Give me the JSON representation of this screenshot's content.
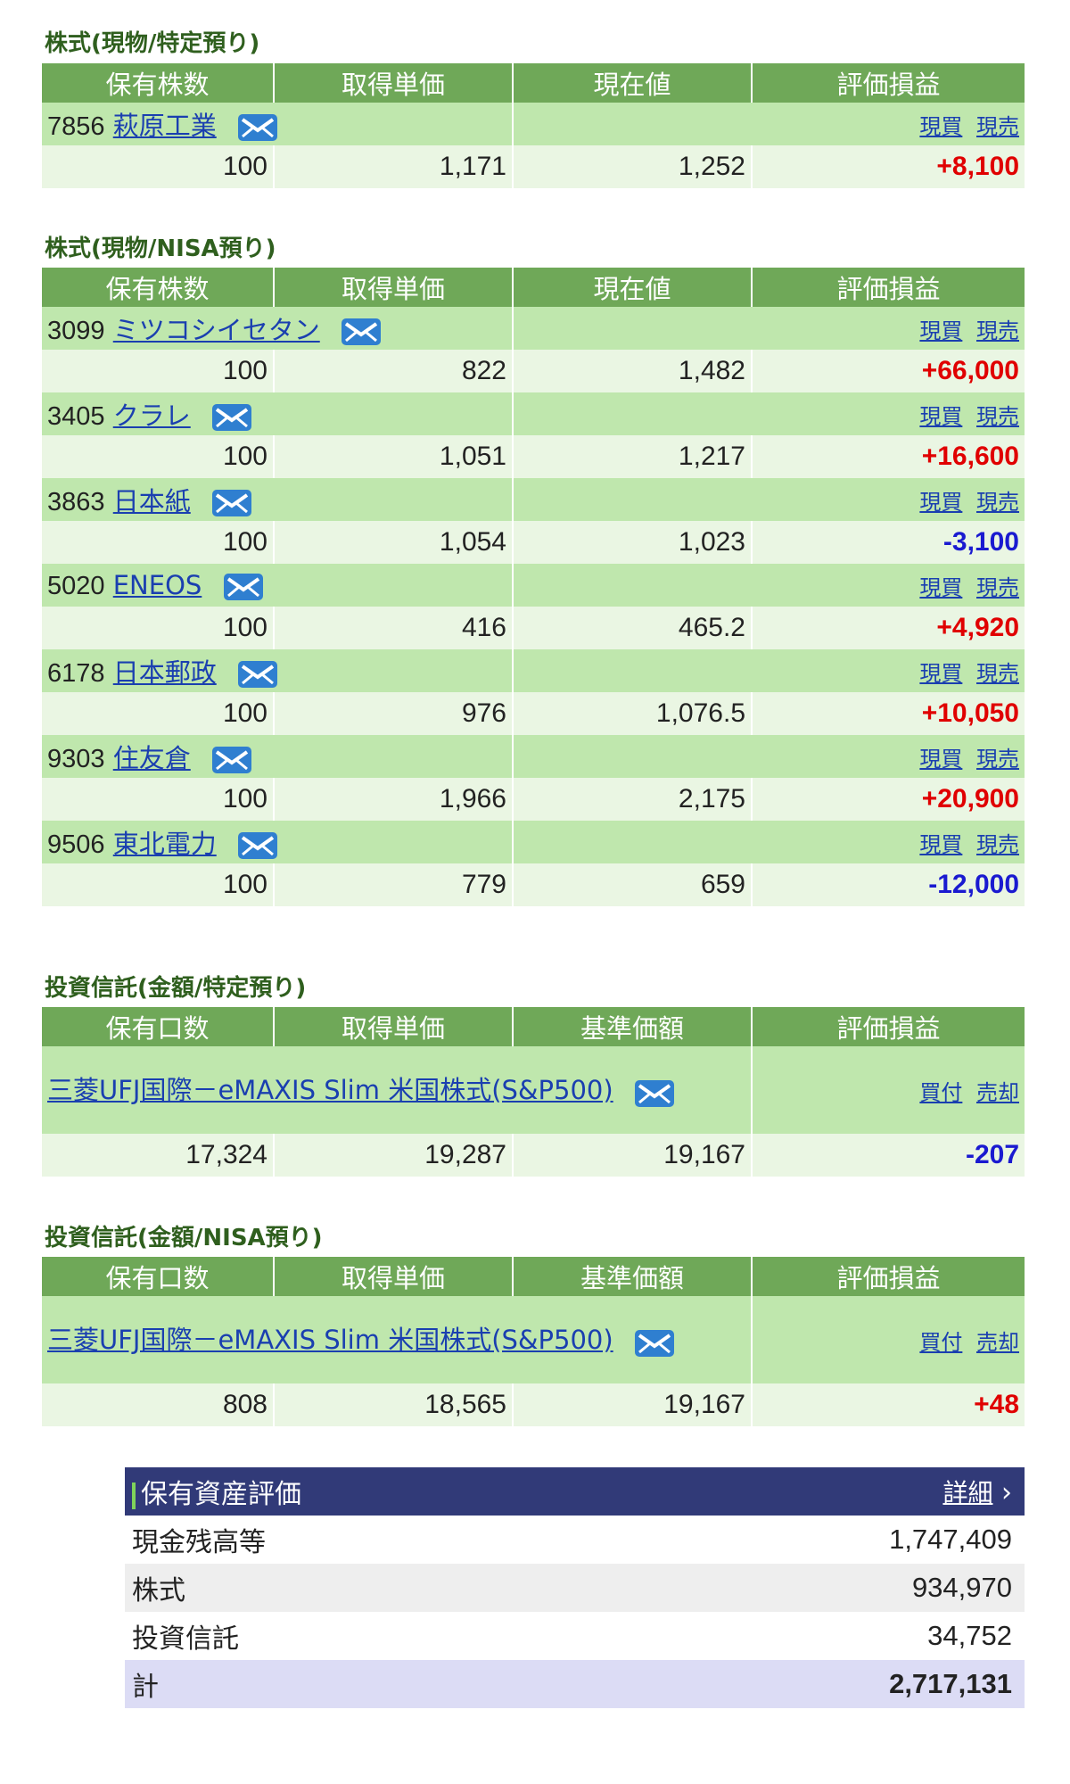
{
  "sections": [
    {
      "title": "株式(現物/特定預り)",
      "headers": [
        "保有株数",
        "取得単価",
        "現在値",
        "評価損益"
      ],
      "items": [
        {
          "code": "7856",
          "name": "萩原工業",
          "trade": [
            "現買",
            "現売"
          ],
          "qty": "100",
          "cost": "1,171",
          "price": "1,252",
          "pl": "+8,100",
          "sign": "pos"
        }
      ]
    },
    {
      "title": "株式(現物/NISA預り)",
      "headers": [
        "保有株数",
        "取得単価",
        "現在値",
        "評価損益"
      ],
      "items": [
        {
          "code": "3099",
          "name": "ミツコシイセタン",
          "trade": [
            "現買",
            "現売"
          ],
          "qty": "100",
          "cost": "822",
          "price": "1,482",
          "pl": "+66,000",
          "sign": "pos"
        },
        {
          "code": "3405",
          "name": "クラレ",
          "trade": [
            "現買",
            "現売"
          ],
          "qty": "100",
          "cost": "1,051",
          "price": "1,217",
          "pl": "+16,600",
          "sign": "pos"
        },
        {
          "code": "3863",
          "name": "日本紙",
          "trade": [
            "現買",
            "現売"
          ],
          "qty": "100",
          "cost": "1,054",
          "price": "1,023",
          "pl": "-3,100",
          "sign": "neg"
        },
        {
          "code": "5020",
          "name": "ENEOS",
          "trade": [
            "現買",
            "現売"
          ],
          "qty": "100",
          "cost": "416",
          "price": "465.2",
          "pl": "+4,920",
          "sign": "pos"
        },
        {
          "code": "6178",
          "name": "日本郵政",
          "trade": [
            "現買",
            "現売"
          ],
          "qty": "100",
          "cost": "976",
          "price": "1,076.5",
          "pl": "+10,050",
          "sign": "pos"
        },
        {
          "code": "9303",
          "name": "住友倉",
          "trade": [
            "現買",
            "現売"
          ],
          "qty": "100",
          "cost": "1,966",
          "price": "2,175",
          "pl": "+20,900",
          "sign": "pos"
        },
        {
          "code": "9506",
          "name": "東北電力",
          "trade": [
            "現買",
            "現売"
          ],
          "qty": "100",
          "cost": "779",
          "price": "659",
          "pl": "-12,000",
          "sign": "neg"
        }
      ]
    },
    {
      "title": "投資信託(金額/特定預り)",
      "headers": [
        "保有口数",
        "取得単価",
        "基準価額",
        "評価損益"
      ],
      "items": [
        {
          "fund": true,
          "name": "三菱UFJ国際－eMAXIS Slim 米国株式(S&P500)",
          "trade": [
            "買付",
            "売却"
          ],
          "qty": "17,324",
          "cost": "19,287",
          "price": "19,167",
          "pl": "-207",
          "sign": "neg"
        }
      ]
    },
    {
      "title": "投資信託(金額/NISA預り)",
      "headers": [
        "保有口数",
        "取得単価",
        "基準価額",
        "評価損益"
      ],
      "items": [
        {
          "fund": true,
          "name": "三菱UFJ国際－eMAXIS Slim 米国株式(S&P500)",
          "trade": [
            "買付",
            "売却"
          ],
          "qty": "808",
          "cost": "18,565",
          "price": "19,167",
          "pl": "+48",
          "sign": "pos"
        }
      ]
    }
  ],
  "summary": {
    "title": "保有資産評価",
    "detail_label": "詳細",
    "rows": [
      {
        "label": "現金残高等",
        "value": "1,747,409"
      },
      {
        "label": "株式",
        "value": "934,970"
      },
      {
        "label": "投資信託",
        "value": "34,752"
      }
    ],
    "total_label": "計",
    "total_value": "2,717,131"
  },
  "colors": {
    "header_green": "#6fa858",
    "name_row": "#bfe7ad",
    "data_row": "#eaf6e3",
    "positive": "#e00000",
    "negative": "#1a1ad0",
    "summary_header": "#313a78"
  },
  "icons": {
    "mail": "envelope-icon",
    "detail_arrow": "chevron-right-icon"
  }
}
